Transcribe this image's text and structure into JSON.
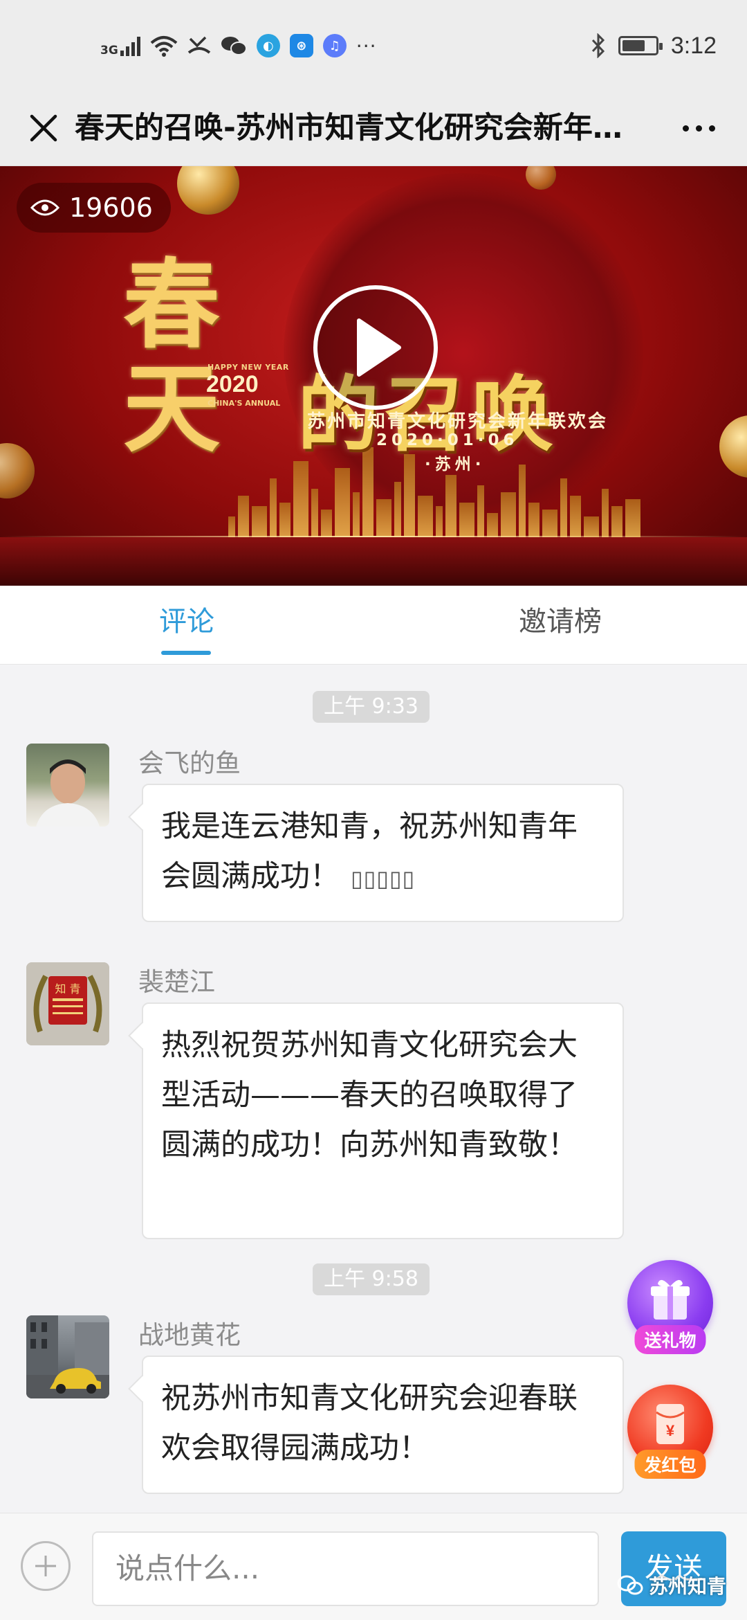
{
  "status_bar": {
    "network": "3G",
    "time": "3:12",
    "icons": [
      "signal-icon",
      "wifi-icon",
      "missed-call-icon",
      "wechat-icon",
      "app-icon",
      "app-icon",
      "music-icon",
      "more-notifications-icon",
      "bluetooth-icon",
      "battery-icon"
    ],
    "battery_level": 0.7
  },
  "header": {
    "title": "春天的召唤-苏州市知青文化研究会新年联欢会"
  },
  "video": {
    "view_count": "19606",
    "poster": {
      "calligraphy": "春天",
      "happy_new_year": "HAPPY NEW YEAR",
      "year": "2020",
      "annual": "CHINA'S ANNUAL",
      "headline": "的召唤",
      "subtitle": "苏州市知青文化研究会新年联欢会",
      "date": "2020·01·06",
      "city": "·苏州·"
    }
  },
  "tabs": [
    {
      "label": "评论",
      "active": true
    },
    {
      "label": "邀请榜",
      "active": false
    }
  ],
  "feed": {
    "timestamps": [
      "上午 9:33",
      "上午 9:58"
    ],
    "comments": [
      {
        "name": "会飞的鱼",
        "text": "我是连云港知青，祝苏州知青年会圆满成功！",
        "emoji": "▯▯▯▯▯"
      },
      {
        "name": "裴楚江",
        "text": "热烈祝贺苏州知青文化研究会大型活动———春天的召唤取得了圆满的成功！向苏州知青致敬！",
        "emoji": ""
      },
      {
        "name": "战地黄花",
        "text": "祝苏州市知青文化研究会迎春联欢会取得园满成功！",
        "emoji": ""
      }
    ]
  },
  "floating": {
    "gift_label": "送礼物",
    "red_packet_label": "发红包",
    "red_packet_symbol": "¥"
  },
  "input_bar": {
    "placeholder": "说点什么...",
    "send_label": "发送"
  },
  "watermark": "苏州知青",
  "colors": {
    "accent": "#2f9bd9",
    "gift": "#8a3cf0",
    "red_packet": "#f03a22"
  }
}
